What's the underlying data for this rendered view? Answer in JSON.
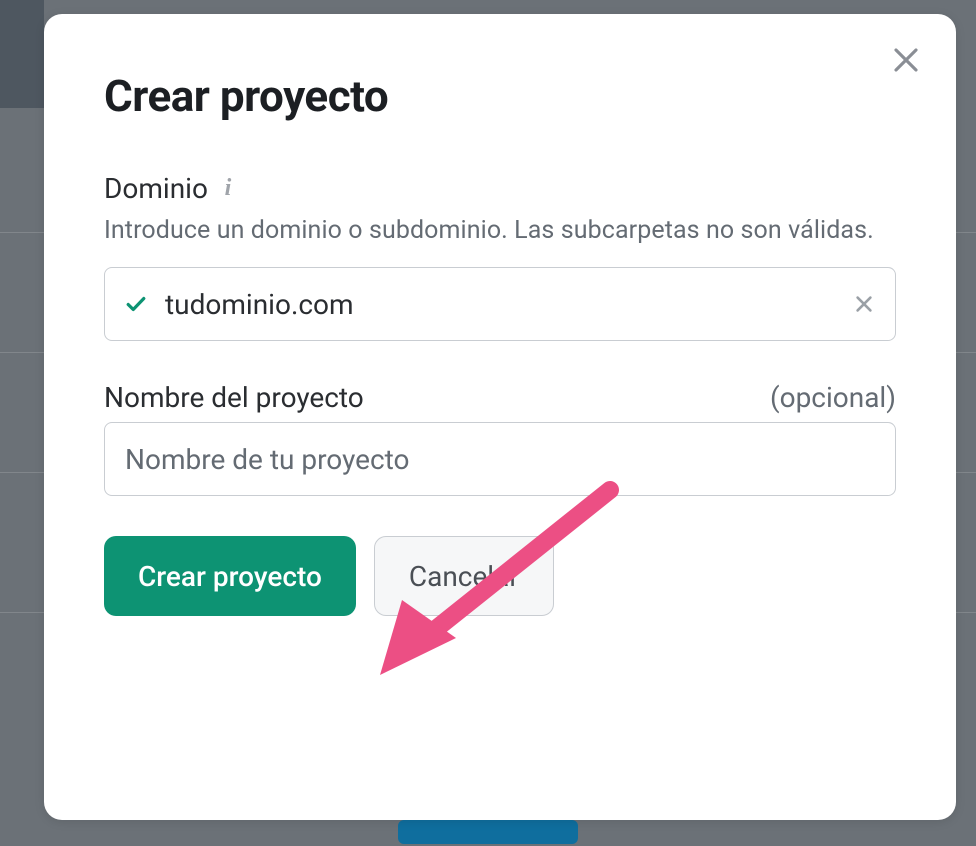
{
  "modal": {
    "title": "Crear proyecto",
    "domain_field": {
      "label": "Dominio",
      "help": "Introduce un dominio o subdominio. Las subcarpetas no son válidas.",
      "value": "tudominio.com"
    },
    "name_field": {
      "label": "Nombre del proyecto",
      "optional_label": "(opcional)",
      "placeholder": "Nombre de tu proyecto",
      "value": ""
    },
    "buttons": {
      "create": "Crear proyecto",
      "cancel": "Cancelar"
    }
  },
  "colors": {
    "primary": "#0d9373",
    "accent_arrow": "#ec4f84",
    "text": "#2a2d31",
    "muted": "#646b73"
  }
}
